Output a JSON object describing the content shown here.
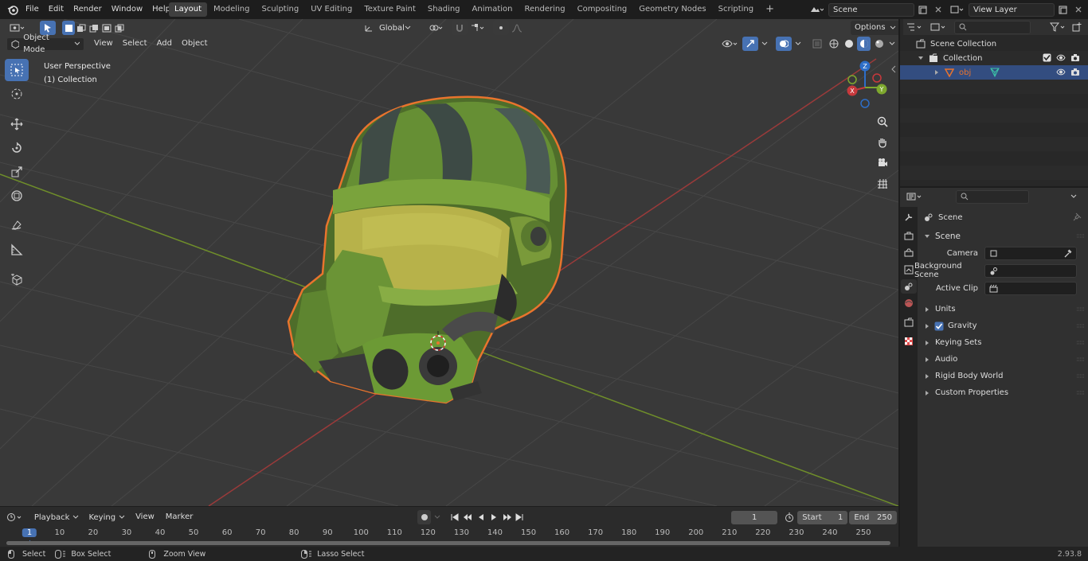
{
  "topbar": {
    "menus": [
      "File",
      "Edit",
      "Render",
      "Window",
      "Help"
    ],
    "workspaces": [
      "Layout",
      "Modeling",
      "Sculpting",
      "UV Editing",
      "Texture Paint",
      "Shading",
      "Animation",
      "Rendering",
      "Compositing",
      "Geometry Nodes",
      "Scripting"
    ],
    "active_workspace": "Layout",
    "scene_name": "Scene",
    "view_layer": "View Layer"
  },
  "viewport": {
    "transform_orientation": "Global",
    "options_label": "Options",
    "mode": "Object Mode",
    "header_menus": [
      "View",
      "Select",
      "Add",
      "Object"
    ],
    "overlay_title": "User Perspective",
    "overlay_collection": "(1) Collection",
    "gizmo_axes": {
      "x": "X",
      "y": "Y",
      "z": "Z"
    }
  },
  "outliner": {
    "scene_collection": "Scene Collection",
    "collection": "Collection",
    "object": "obj"
  },
  "properties": {
    "header": "Scene",
    "panel_title": "Scene",
    "camera_label": "Camera",
    "background_scene_label": "Background Scene",
    "active_clip_label": "Active Clip",
    "subpanels": [
      "Units",
      "Gravity",
      "Keying Sets",
      "Audio",
      "Rigid Body World",
      "Custom Properties"
    ]
  },
  "timeline": {
    "menus": [
      "Playback",
      "Keying",
      "View",
      "Marker"
    ],
    "current_frame": "1",
    "start_label": "Start",
    "start_value": "1",
    "end_label": "End",
    "end_value": "250",
    "ruler": [
      "1",
      "10",
      "20",
      "30",
      "40",
      "50",
      "60",
      "70",
      "80",
      "90",
      "100",
      "110",
      "120",
      "130",
      "140",
      "150",
      "160",
      "170",
      "180",
      "190",
      "200",
      "210",
      "220",
      "230",
      "240",
      "250"
    ]
  },
  "statusbar": {
    "select": "Select",
    "box_select": "Box Select",
    "zoom_view": "Zoom View",
    "lasso_select": "Lasso Select",
    "version": "2.93.8"
  },
  "colors": {
    "accent": "#4772b3",
    "object_outline": "#e9742d",
    "x_axis": "#b2403f",
    "y_axis": "#7a9a2b",
    "helmet_green": "#6c9a35"
  }
}
